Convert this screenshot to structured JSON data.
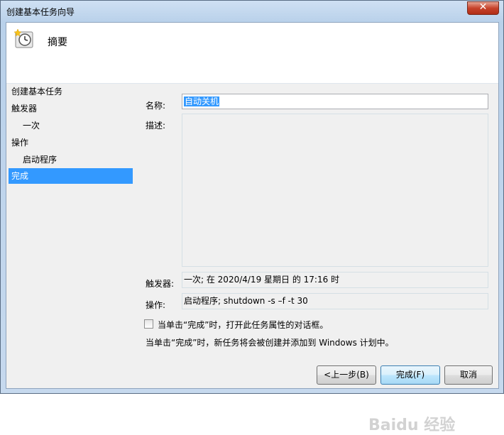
{
  "window": {
    "title": "创建基本任务向导",
    "close_glyph": "✕"
  },
  "header": {
    "title": "摘要",
    "icon": "clock-icon"
  },
  "nav": {
    "items": [
      {
        "label": "创建基本任务"
      },
      {
        "label": "触发器"
      },
      {
        "label": "一次"
      },
      {
        "label": "操作"
      },
      {
        "label": "启动程序"
      },
      {
        "label": "完成"
      }
    ]
  },
  "form": {
    "name_label": "名称:",
    "name_value": "自动关机",
    "desc_label": "描述:",
    "desc_value": "",
    "trigger_label": "触发器:",
    "trigger_value": "一次; 在 2020/4/19 星期日 的 17:16 时",
    "action_label": "操作:",
    "action_value": "启动程序; shutdown -s –f -t 30",
    "checkbox_label": "当单击“完成”时，打开此任务属性的对话框。",
    "info_text": "当单击“完成”时，新任务将会被创建并添加到 Windows 计划中。"
  },
  "buttons": {
    "back": "<上一步(B)",
    "finish": "完成(F)",
    "cancel": "取消"
  },
  "watermark": "Baidu 经验",
  "colors": {
    "selection": "#3399ff",
    "panel": "#f0f0f0"
  }
}
